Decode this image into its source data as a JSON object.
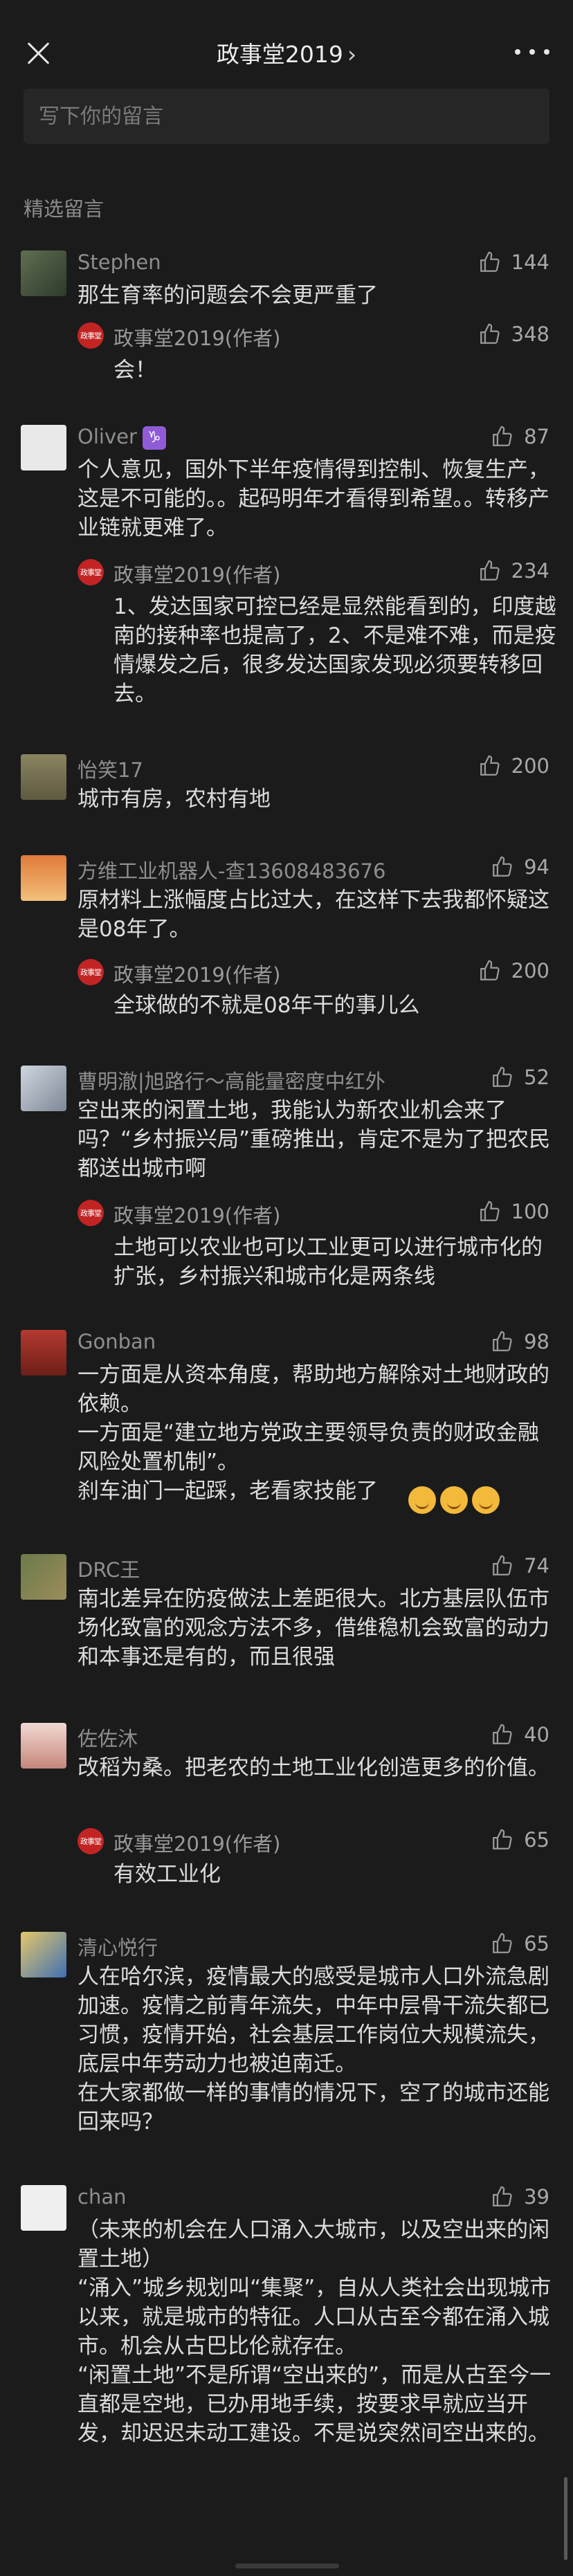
{
  "header": {
    "title": "政事堂2019",
    "title_chevron": "›"
  },
  "comment_input": {
    "placeholder": "写下你的留言"
  },
  "section_title": "精选留言",
  "reply_badge_text": "政事堂",
  "comments": [
    {
      "name": "Stephen",
      "likes": "144",
      "text": "那生育率的问题会不会更严重了",
      "reply": {
        "name": "政事堂2019(作者)",
        "likes": "348",
        "text": "会！"
      }
    },
    {
      "name": "Oliver",
      "sign": "♑",
      "likes": "87",
      "text": "个人意见，国外下半年疫情得到控制、恢复生产，这是不可能的。。起码明年才看得到希望。。转移产业链就更难了。",
      "reply": {
        "name": "政事堂2019(作者)",
        "likes": "234",
        "text": "1、发达国家可控已经是显然能看到的，印度越南的接种率也提高了，2、不是难不难，而是疫情爆发之后，很多发达国家发现必须要转移回去。"
      }
    },
    {
      "name": "怡笑17",
      "likes": "200",
      "text": "城市有房，农村有地"
    },
    {
      "name": "方维工业机器人-查13608483676",
      "likes": "94",
      "text": "原材料上涨幅度占比过大，在这样下去我都怀疑这是08年了。",
      "reply": {
        "name": "政事堂2019(作者)",
        "likes": "200",
        "text": "全球做的不就是08年干的事儿么"
      }
    },
    {
      "name": "曹明澈|旭路行～高能量密度中红外",
      "likes": "52",
      "text": "空出来的闲置土地，我能认为新农业机会来了吗？“乡村振兴局”重磅推出，肯定不是为了把农民都送出城市啊",
      "reply": {
        "name": "政事堂2019(作者)",
        "likes": "100",
        "text": "土地可以农业也可以工业更可以进行城市化的扩张，乡村振兴和城市化是两条线"
      }
    },
    {
      "name": "Gonban",
      "likes": "98",
      "text": "一方面是从资本角度，帮助地方解除对土地财政的依赖。\n一方面是“建立地方党政主要领导负责的财政金融风险处置机制”。\n刹车油门一起踩，老看家技能了"
    },
    {
      "name": "DRC王",
      "likes": "74",
      "text": "南北差异在防疫做法上差距很大。北方基层队伍市场化致富的观念方法不多，借维稳机会致富的动力和本事还是有的，而且很强"
    },
    {
      "name": "佐佐沐",
      "likes": "40",
      "text": "改稻为桑。把老农的土地工业化创造更多的价值。",
      "reply": {
        "name": "政事堂2019(作者)",
        "likes": "65",
        "text": "有效工业化"
      }
    },
    {
      "name": "清心悦行",
      "likes": "65",
      "text": "人在哈尔滨，疫情最大的感受是城市人口外流急剧加速。疫情之前青年流失，中年中层骨干流失都已习惯，疫情开始，社会基层工作岗位大规模流失，底层中年劳动力也被迫南迁。\n在大家都做一样的事情的情况下，空了的城市还能回来吗？"
    },
    {
      "name": "chan",
      "likes": "39",
      "text": "（未来的机会在人口涌入大城市，以及空出来的闲置土地）\n“涌入”城乡规划叫“集聚”，自从人类社会出现城市以来，就是城市的特征。人口从古至今都在涌入城市。机会从古巴比伦就存在。\n“闲置土地”不是所谓“空出来的”，而是从古至今一直都是空地，已办用地手续，按要求早就应当开发，却迟迟未动工建设。不是说突然间空出来的。"
    }
  ],
  "colors": {
    "background": "#1b1b1b",
    "badge": "#c22424",
    "emoji": "#f2b93b"
  }
}
